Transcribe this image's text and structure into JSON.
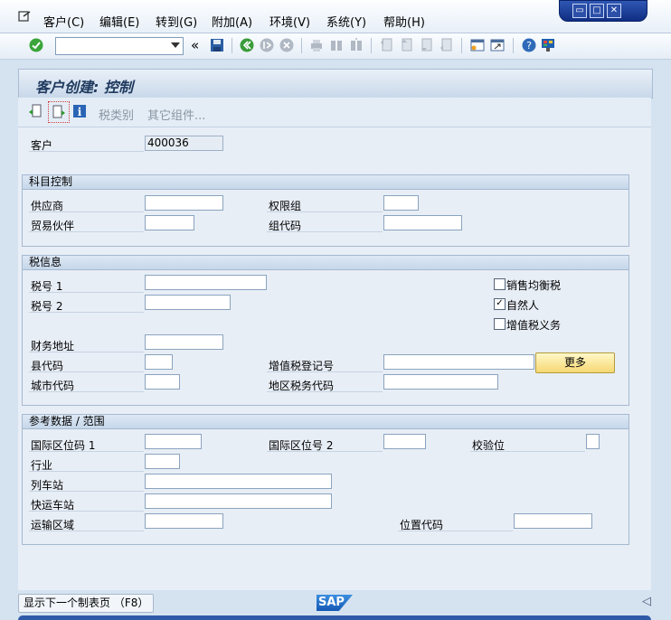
{
  "menu": {
    "items": [
      "客户(C)",
      "编辑(E)",
      "转到(G)",
      "附加(A)",
      "环境(V)",
      "系统(Y)",
      "帮助(H)"
    ]
  },
  "window_controls": [
    "minimize-restore",
    "maximize",
    "close"
  ],
  "toolbar": {
    "command_field_value": "",
    "back_label": "«"
  },
  "screen": {
    "title": "客户创建: 控制"
  },
  "app_toolbar": {
    "tax_category": "税类别",
    "other_components": "其它组件..."
  },
  "customer": {
    "label": "客户",
    "value": "400036"
  },
  "account_control": {
    "title": "科目控制",
    "vendor_label": "供应商",
    "vendor_value": "",
    "auth_group_label": "权限组",
    "auth_group_value": "",
    "trading_partner_label": "贸易伙伴",
    "trading_partner_value": "",
    "group_key_label": "组代码",
    "group_key_value": ""
  },
  "tax_info": {
    "title": "税信息",
    "tax1_label": "税号 1",
    "tax2_label": "税号 2",
    "fiscal_address_label": "财务地址",
    "county_code_label": "县代码",
    "city_code_label": "城市代码",
    "vat_reg_label": "增值税登记号",
    "jurisdiction_label": "地区税务代码",
    "more_button": "更多",
    "equalization_tax": {
      "label": "销售均衡税",
      "checked": false
    },
    "natural_person": {
      "label": "自然人",
      "checked": true
    },
    "vat_liable": {
      "label": "增值税义务",
      "checked": false
    }
  },
  "reference_data": {
    "title": "参考数据 / 范围",
    "intl_loc1_label": "国际区位码 1",
    "intl_loc2_label": "国际区位号 2",
    "check_digit_label": "校验位",
    "industry_label": "行业",
    "train_station_label": "列车站",
    "express_station_label": "快运车站",
    "transport_zone_label": "运输区域",
    "location_code_label": "位置代码"
  },
  "status": {
    "next_tab_button": "显示下一个制表页 （F8）",
    "sap_logo": "SAP",
    "collapse_arrow": "◁"
  }
}
